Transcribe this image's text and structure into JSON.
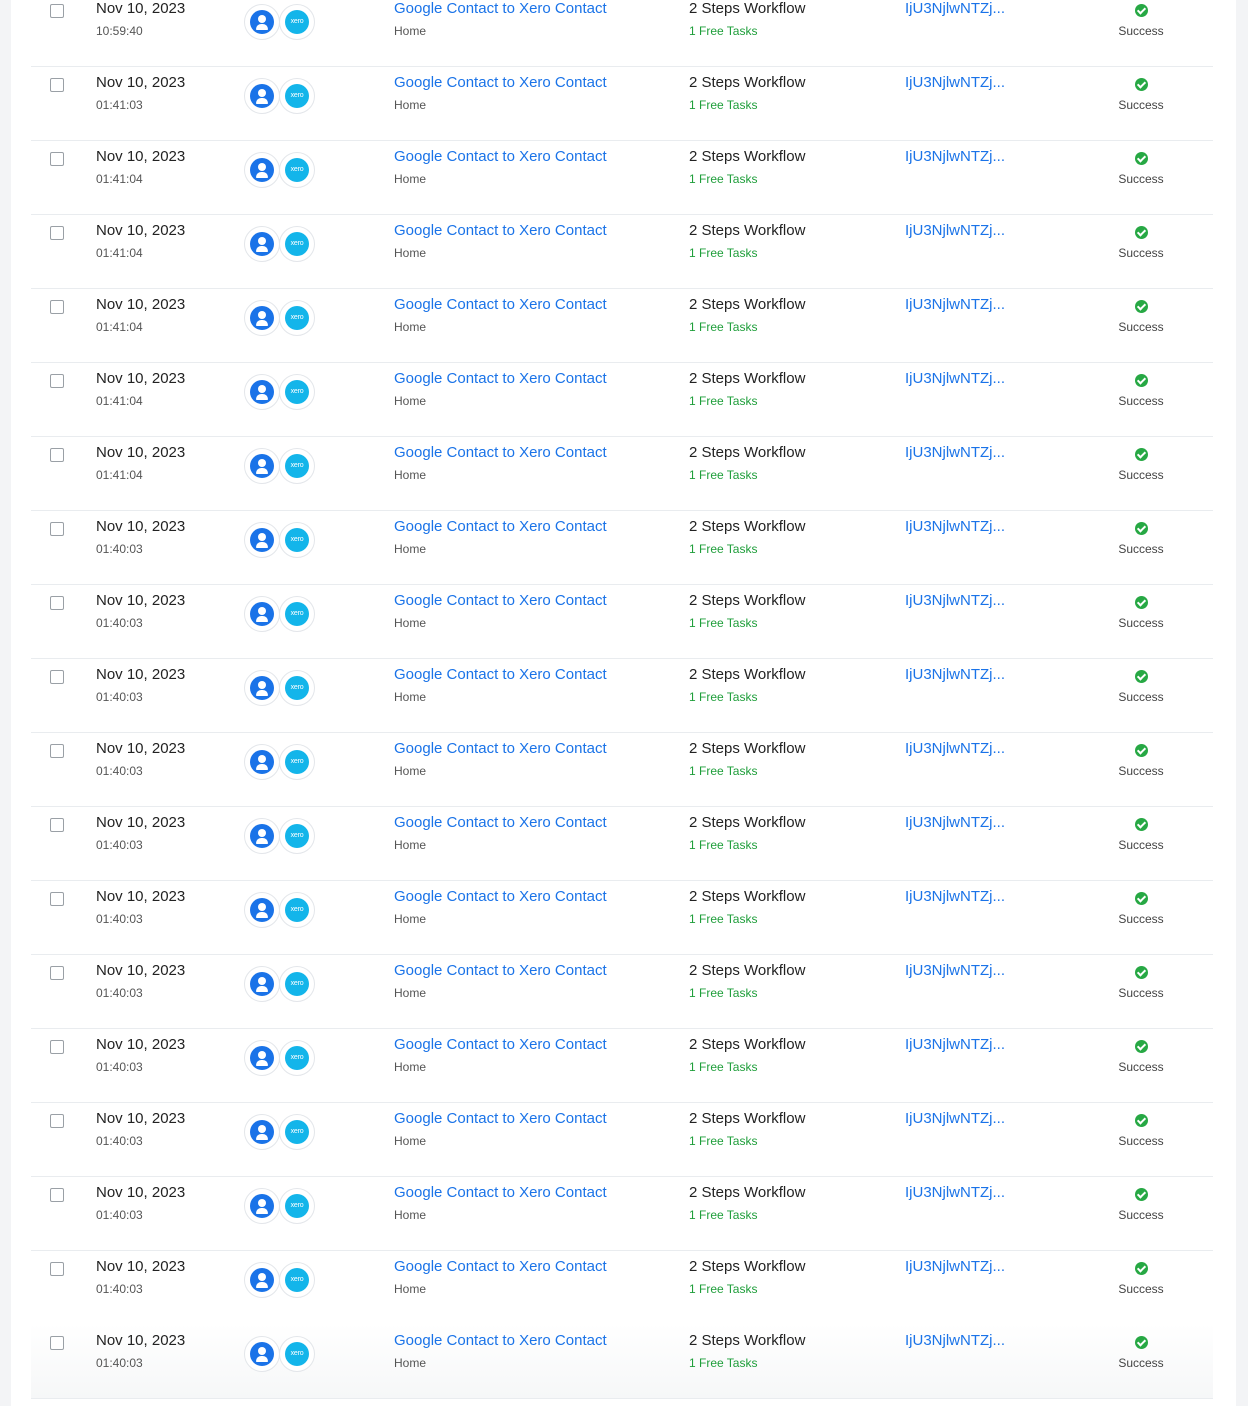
{
  "rows": [
    {
      "date": "Nov 10, 2023",
      "time": "10:59:40",
      "app1_icon": "google-contacts-icon",
      "app2_icon": "xero-icon",
      "app2_text": "xero",
      "workflow": "Google Contact to Xero Contact",
      "folder": "Home",
      "steps": "2 Steps Workflow",
      "tasks": "1 Free Tasks",
      "task_id": "IjU3NjlwNTZj...",
      "status": "Success"
    },
    {
      "date": "Nov 10, 2023",
      "time": "01:41:03",
      "app1_icon": "google-contacts-icon",
      "app2_icon": "xero-icon",
      "app2_text": "xero",
      "workflow": "Google Contact to Xero Contact",
      "folder": "Home",
      "steps": "2 Steps Workflow",
      "tasks": "1 Free Tasks",
      "task_id": "IjU3NjlwNTZj...",
      "status": "Success"
    },
    {
      "date": "Nov 10, 2023",
      "time": "01:41:04",
      "app1_icon": "google-contacts-icon",
      "app2_icon": "xero-icon",
      "app2_text": "xero",
      "workflow": "Google Contact to Xero Contact",
      "folder": "Home",
      "steps": "2 Steps Workflow",
      "tasks": "1 Free Tasks",
      "task_id": "IjU3NjlwNTZj...",
      "status": "Success"
    },
    {
      "date": "Nov 10, 2023",
      "time": "01:41:04",
      "app1_icon": "google-contacts-icon",
      "app2_icon": "xero-icon",
      "app2_text": "xero",
      "workflow": "Google Contact to Xero Contact",
      "folder": "Home",
      "steps": "2 Steps Workflow",
      "tasks": "1 Free Tasks",
      "task_id": "IjU3NjlwNTZj...",
      "status": "Success"
    },
    {
      "date": "Nov 10, 2023",
      "time": "01:41:04",
      "app1_icon": "google-contacts-icon",
      "app2_icon": "xero-icon",
      "app2_text": "xero",
      "workflow": "Google Contact to Xero Contact",
      "folder": "Home",
      "steps": "2 Steps Workflow",
      "tasks": "1 Free Tasks",
      "task_id": "IjU3NjlwNTZj...",
      "status": "Success"
    },
    {
      "date": "Nov 10, 2023",
      "time": "01:41:04",
      "app1_icon": "google-contacts-icon",
      "app2_icon": "xero-icon",
      "app2_text": "xero",
      "workflow": "Google Contact to Xero Contact",
      "folder": "Home",
      "steps": "2 Steps Workflow",
      "tasks": "1 Free Tasks",
      "task_id": "IjU3NjlwNTZj...",
      "status": "Success"
    },
    {
      "date": "Nov 10, 2023",
      "time": "01:41:04",
      "app1_icon": "google-contacts-icon",
      "app2_icon": "xero-icon",
      "app2_text": "xero",
      "workflow": "Google Contact to Xero Contact",
      "folder": "Home",
      "steps": "2 Steps Workflow",
      "tasks": "1 Free Tasks",
      "task_id": "IjU3NjlwNTZj...",
      "status": "Success"
    },
    {
      "date": "Nov 10, 2023",
      "time": "01:40:03",
      "app1_icon": "google-contacts-icon",
      "app2_icon": "xero-icon",
      "app2_text": "xero",
      "workflow": "Google Contact to Xero Contact",
      "folder": "Home",
      "steps": "2 Steps Workflow",
      "tasks": "1 Free Tasks",
      "task_id": "IjU3NjlwNTZj...",
      "status": "Success"
    },
    {
      "date": "Nov 10, 2023",
      "time": "01:40:03",
      "app1_icon": "google-contacts-icon",
      "app2_icon": "xero-icon",
      "app2_text": "xero",
      "workflow": "Google Contact to Xero Contact",
      "folder": "Home",
      "steps": "2 Steps Workflow",
      "tasks": "1 Free Tasks",
      "task_id": "IjU3NjlwNTZj...",
      "status": "Success"
    },
    {
      "date": "Nov 10, 2023",
      "time": "01:40:03",
      "app1_icon": "google-contacts-icon",
      "app2_icon": "xero-icon",
      "app2_text": "xero",
      "workflow": "Google Contact to Xero Contact",
      "folder": "Home",
      "steps": "2 Steps Workflow",
      "tasks": "1 Free Tasks",
      "task_id": "IjU3NjlwNTZj...",
      "status": "Success"
    },
    {
      "date": "Nov 10, 2023",
      "time": "01:40:03",
      "app1_icon": "google-contacts-icon",
      "app2_icon": "xero-icon",
      "app2_text": "xero",
      "workflow": "Google Contact to Xero Contact",
      "folder": "Home",
      "steps": "2 Steps Workflow",
      "tasks": "1 Free Tasks",
      "task_id": "IjU3NjlwNTZj...",
      "status": "Success"
    },
    {
      "date": "Nov 10, 2023",
      "time": "01:40:03",
      "app1_icon": "google-contacts-icon",
      "app2_icon": "xero-icon",
      "app2_text": "xero",
      "workflow": "Google Contact to Xero Contact",
      "folder": "Home",
      "steps": "2 Steps Workflow",
      "tasks": "1 Free Tasks",
      "task_id": "IjU3NjlwNTZj...",
      "status": "Success"
    },
    {
      "date": "Nov 10, 2023",
      "time": "01:40:03",
      "app1_icon": "google-contacts-icon",
      "app2_icon": "xero-icon",
      "app2_text": "xero",
      "workflow": "Google Contact to Xero Contact",
      "folder": "Home",
      "steps": "2 Steps Workflow",
      "tasks": "1 Free Tasks",
      "task_id": "IjU3NjlwNTZj...",
      "status": "Success"
    },
    {
      "date": "Nov 10, 2023",
      "time": "01:40:03",
      "app1_icon": "google-contacts-icon",
      "app2_icon": "xero-icon",
      "app2_text": "xero",
      "workflow": "Google Contact to Xero Contact",
      "folder": "Home",
      "steps": "2 Steps Workflow",
      "tasks": "1 Free Tasks",
      "task_id": "IjU3NjlwNTZj...",
      "status": "Success"
    },
    {
      "date": "Nov 10, 2023",
      "time": "01:40:03",
      "app1_icon": "google-contacts-icon",
      "app2_icon": "xero-icon",
      "app2_text": "xero",
      "workflow": "Google Contact to Xero Contact",
      "folder": "Home",
      "steps": "2 Steps Workflow",
      "tasks": "1 Free Tasks",
      "task_id": "IjU3NjlwNTZj...",
      "status": "Success"
    },
    {
      "date": "Nov 10, 2023",
      "time": "01:40:03",
      "app1_icon": "google-contacts-icon",
      "app2_icon": "xero-icon",
      "app2_text": "xero",
      "workflow": "Google Contact to Xero Contact",
      "folder": "Home",
      "steps": "2 Steps Workflow",
      "tasks": "1 Free Tasks",
      "task_id": "IjU3NjlwNTZj...",
      "status": "Success"
    },
    {
      "date": "Nov 10, 2023",
      "time": "01:40:03",
      "app1_icon": "google-contacts-icon",
      "app2_icon": "xero-icon",
      "app2_text": "xero",
      "workflow": "Google Contact to Xero Contact",
      "folder": "Home",
      "steps": "2 Steps Workflow",
      "tasks": "1 Free Tasks",
      "task_id": "IjU3NjlwNTZj...",
      "status": "Success"
    },
    {
      "date": "Nov 10, 2023",
      "time": "01:40:03",
      "app1_icon": "google-contacts-icon",
      "app2_icon": "xero-icon",
      "app2_text": "xero",
      "workflow": "Google Contact to Xero Contact",
      "folder": "Home",
      "steps": "2 Steps Workflow",
      "tasks": "1 Free Tasks",
      "task_id": "IjU3NjlwNTZj...",
      "status": "Success"
    },
    {
      "date": "Nov 10, 2023",
      "time": "01:40:03",
      "app1_icon": "google-contacts-icon",
      "app2_icon": "xero-icon",
      "app2_text": "xero",
      "workflow": "Google Contact to Xero Contact",
      "folder": "Home",
      "steps": "2 Steps Workflow",
      "tasks": "1 Free Tasks",
      "task_id": "IjU3NjlwNTZj...",
      "status": "Success"
    }
  ],
  "colors": {
    "link": "#1a73e8",
    "success": "#27a844",
    "tasks": "#1e9e3a",
    "google": "#1a73e8",
    "xero": "#13b5ea"
  }
}
